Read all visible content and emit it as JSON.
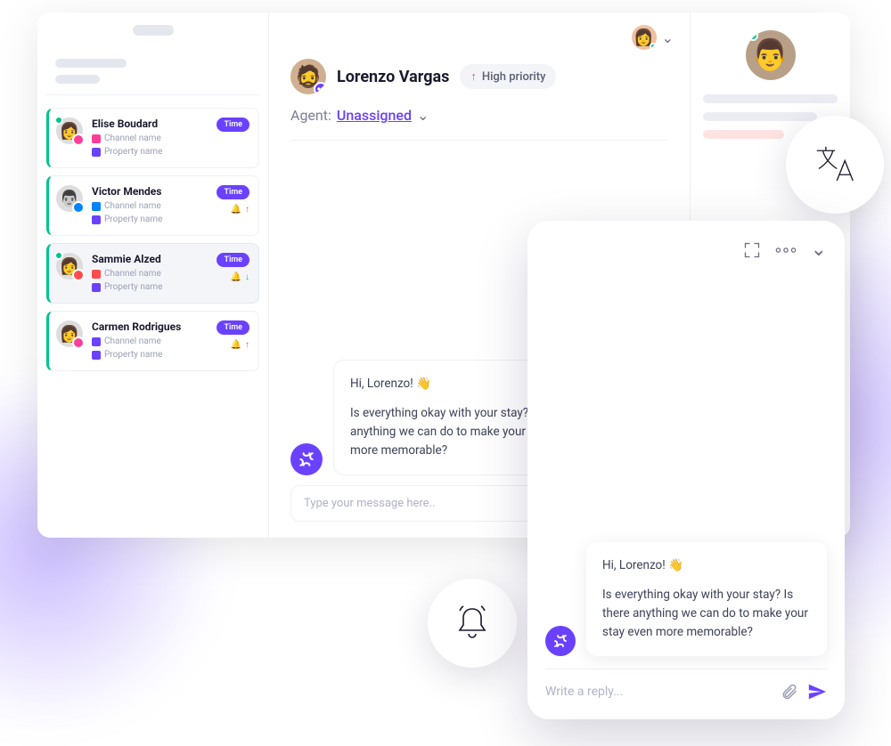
{
  "header": {
    "user_avatar_emoji": "👩"
  },
  "sidebar": {
    "items": [
      {
        "name": "Elise Boudard",
        "channel": "Channel name",
        "property": "Property name",
        "time": "Time",
        "avatar_emoji": "👩",
        "badge": "pink",
        "status_online": true,
        "icon_up": false,
        "icon_down": false
      },
      {
        "name": "Victor Mendes",
        "channel": "Channel name",
        "property": "Property name",
        "time": "Time",
        "avatar_emoji": "👨",
        "badge": "blue",
        "status_online": false,
        "icon_up": true,
        "icon_down": false
      },
      {
        "name": "Sammie Alzed",
        "channel": "Channel name",
        "property": "Property name",
        "time": "Time",
        "avatar_emoji": "👩",
        "badge": "red",
        "status_online": true,
        "icon_up": false,
        "icon_down": true
      },
      {
        "name": "Carmen Rodrigues",
        "channel": "Channel name",
        "property": "Property name",
        "time": "Time",
        "avatar_emoji": "👩",
        "badge": "pink",
        "status_online": false,
        "icon_up": true,
        "icon_down": false
      }
    ]
  },
  "chat": {
    "contact_name": "Lorenzo Vargas",
    "contact_avatar_emoji": "🧔",
    "priority_label": "High priority",
    "agent_label": "Agent:",
    "agent_value": "Unassigned",
    "message": {
      "line1": "Hi, Lorenzo! 👋",
      "line2": "Is everything okay with your stay? Is there anything we can do to make your stay even more memorable?"
    },
    "input_placeholder": "Type your message here.."
  },
  "detail": {
    "avatar_emoji": "👨"
  },
  "mobile": {
    "message": {
      "line1": "Hi, Lorenzo! 👋",
      "line2": "Is everything okay with your stay? Is there anything we can do to make your stay even more memorable?"
    },
    "reply_placeholder": "Write a reply..."
  }
}
